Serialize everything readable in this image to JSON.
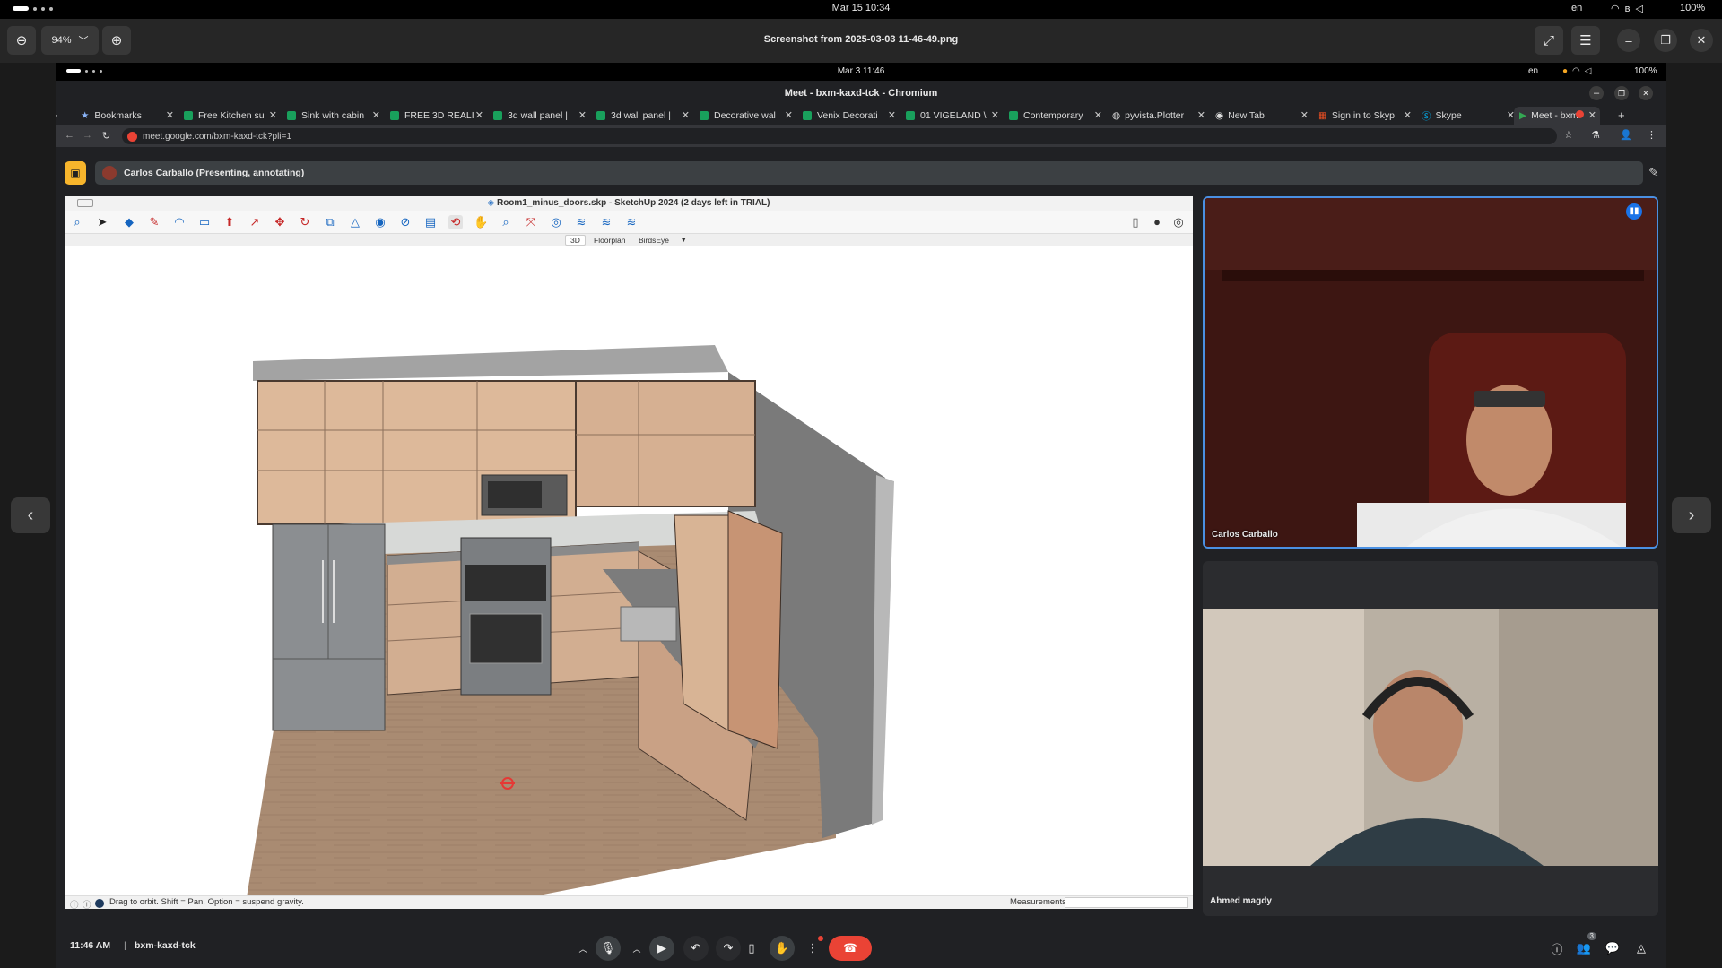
{
  "system_bar": {
    "datetime": "Mar 15  10:34",
    "lang": "en",
    "battery": "100%"
  },
  "viewer": {
    "zoom": "94%",
    "title": "Screenshot from 2025-03-03 11-46-49.png"
  },
  "inner_system_bar": {
    "datetime": "Mar 3  11:46",
    "lang": "en",
    "battery": "100%"
  },
  "browser": {
    "window_title": "Meet - bxm-kaxd-tck - Chromium",
    "tabs": [
      {
        "label": "Bookmarks"
      },
      {
        "label": "Free Kitchen su"
      },
      {
        "label": "Sink with cabin"
      },
      {
        "label": "FREE 3D REALI"
      },
      {
        "label": "3d wall panel |"
      },
      {
        "label": "3d wall panel |"
      },
      {
        "label": "Decorative wal"
      },
      {
        "label": "Venix Decorati"
      },
      {
        "label": "01 VIGELAND \\"
      },
      {
        "label": "Contemporary"
      },
      {
        "label": "pyvista.Plotter"
      },
      {
        "label": "New Tab"
      },
      {
        "label": "Sign in to Skyp"
      },
      {
        "label": "Skype"
      },
      {
        "label": "Meet - bxm"
      }
    ],
    "new_tab": "+",
    "url": "meet.google.com/bxm-kaxd-tck?pli=1"
  },
  "meet": {
    "presenter_label": "Carlos Carballo (Presenting, annotating)",
    "sketchup": {
      "title": "Room1_minus_doors.skp - SketchUp 2024 (2 days left in TRIAL)",
      "view_tabs": [
        "3D",
        "Floorplan",
        "BirdsEye"
      ],
      "status_text": "Drag to orbit. Shift = Pan, Option = suspend gravity.",
      "measurements_label": "Measurements"
    },
    "participants": [
      {
        "name": "Carlos Carballo"
      },
      {
        "name": "Ahmed magdy"
      }
    ],
    "time": "11:46 AM",
    "meeting_code": "bxm-kaxd-tck",
    "people_count": "3"
  },
  "colors": {
    "accent_blue": "#4a90e2",
    "end_call_red": "#ea4335",
    "presenting_orange": "#f7b52c"
  }
}
